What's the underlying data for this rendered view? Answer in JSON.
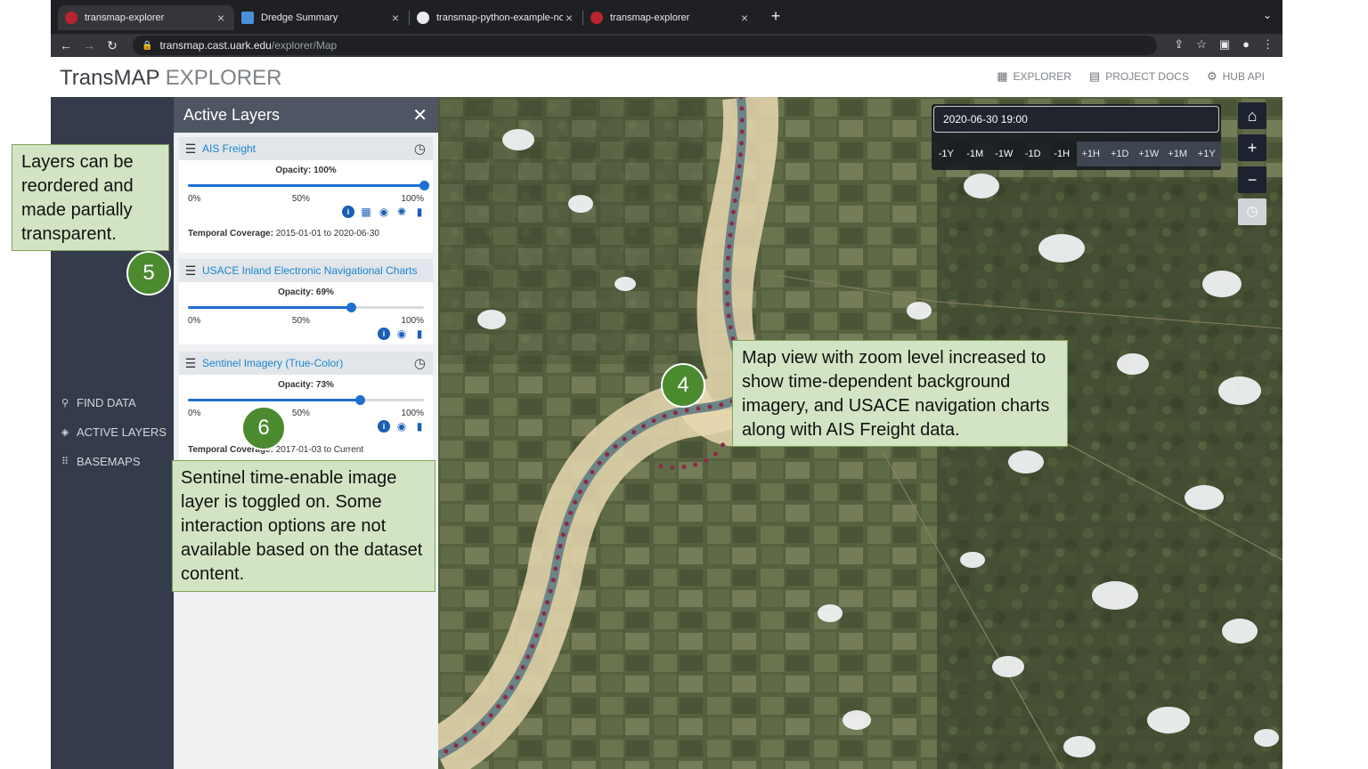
{
  "browser": {
    "tabs": [
      {
        "title": "transmap-explorer",
        "active": true
      },
      {
        "title": "Dredge Summary",
        "active": false
      },
      {
        "title": "transmap-python-example-not",
        "active": false
      },
      {
        "title": "transmap-explorer",
        "active": false
      }
    ],
    "url_host": "transmap.cast.uark.edu",
    "url_path": "/explorer/Map"
  },
  "header": {
    "brand_main": "TransMAP",
    "brand_sub": "EXPLORER",
    "nav": [
      {
        "label": "EXPLORER",
        "icon": "map-icon"
      },
      {
        "label": "PROJECT DOCS",
        "icon": "book-icon"
      },
      {
        "label": "HUB API",
        "icon": "chip-icon"
      }
    ]
  },
  "sidebar": {
    "items": [
      {
        "label": "FIND DATA",
        "icon": "search-icon"
      },
      {
        "label": "ACTIVE LAYERS",
        "icon": "layers-icon"
      },
      {
        "label": "BASEMAPS",
        "icon": "grid-icon"
      }
    ]
  },
  "panel": {
    "title": "Active Layers",
    "layers": [
      {
        "name": "AIS Freight",
        "opacity_label": "Opacity: 100%",
        "opacity": 1.0,
        "ticks": [
          "0%",
          "50%",
          "100%"
        ],
        "coverage_label": "Temporal Coverage:",
        "coverage_value": "2015-01-01 to 2020-06-30",
        "has_clock": true,
        "actions": [
          "info-icon",
          "table-icon",
          "eye-icon",
          "palette-icon",
          "trash-icon"
        ]
      },
      {
        "name": "USACE Inland Electronic Navigational Charts",
        "opacity_label": "Opacity: 69%",
        "opacity": 0.69,
        "ticks": [
          "0%",
          "50%",
          "100%"
        ],
        "has_clock": false,
        "actions": [
          "info-icon",
          "eye-icon",
          "trash-icon"
        ]
      },
      {
        "name": "Sentinel Imagery (True-Color)",
        "opacity_label": "Opacity: 73%",
        "opacity": 0.73,
        "ticks": [
          "0%",
          "50%",
          "100%"
        ],
        "coverage_label": "Temporal Coverage:",
        "coverage_value": "2017-01-03 to Current",
        "has_clock": true,
        "actions": [
          "info-icon",
          "eye-icon",
          "trash-icon"
        ]
      }
    ]
  },
  "map": {
    "datetime": "2020-06-30 19:00",
    "steps": [
      "-1Y",
      "-1M",
      "-1W",
      "-1D",
      "-1H",
      "+1H",
      "+1D",
      "+1W",
      "+1M",
      "+1Y"
    ],
    "controls": [
      "home-icon",
      "zoom-in-icon",
      "zoom-out-icon",
      "clock-icon"
    ]
  },
  "annotations": {
    "note5": "Layers can be reordered and made partially transparent.",
    "note4": "Map view with zoom level increased to show time-dependent background imagery, and USACE navigation charts along with AIS Freight data.",
    "note6": "Sentinel time-enable image layer is toggled on. Some interaction options are not available based on the dataset content.",
    "badge5": "5",
    "badge4": "4",
    "badge6": "6"
  },
  "colors": {
    "accent": "#1a87d0",
    "sidebar": "#343b4a",
    "annotation_fill": "#d3e4c4",
    "badge": "#4b8a2f",
    "track_dot": "#8b2b44"
  }
}
